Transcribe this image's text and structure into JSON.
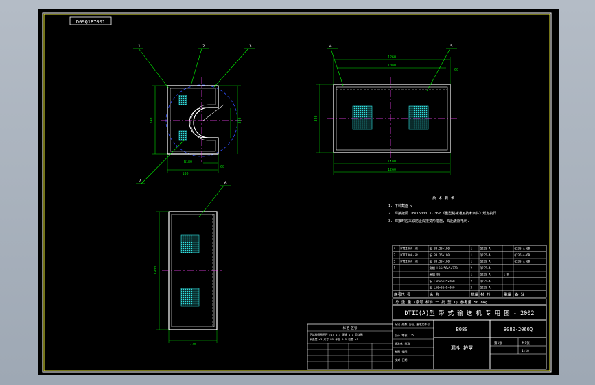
{
  "colors": {
    "background": "#000000",
    "frame": "#ffffff",
    "border_yellow": "#e8e830",
    "geometry_white": "#ffffff",
    "dimension_green": "#00dd00",
    "centerline_magenta": "#ff44ff",
    "hidden_blue": "#3050ff",
    "hatch_cyan": "#30e0e0",
    "leader_green": "#00ff00",
    "table_text": "#ffffff",
    "note_text": "#ffffff"
  },
  "drawing_code_box": "D09Q1B7001",
  "balloons": [
    "1",
    "2",
    "3",
    "4",
    "5",
    "6",
    "7"
  ],
  "notes": {
    "title": "技 术 要 求",
    "items": [
      "1. 下料截面 ▽",
      "2. 焊接按照 JB/T5000.3-1998《重型机械通用技术条件》规定执行.",
      "3. 焊接时应采取防止焊接变形措施, 焊后去除毛刺."
    ]
  },
  "parts_rows": [
    {
      "no": "4",
      "code": "DTII30A-5R",
      "name": "板 B3.25×190",
      "qty": "1",
      "mat": "Q235-A",
      "weight": "",
      "note": "Q235-A-6B"
    },
    {
      "no": "3",
      "code": "DTII30A-5R",
      "name": "板 B3.25×190",
      "qty": "1",
      "mat": "Q235-A",
      "weight": "",
      "note": "Q235-A-6B"
    },
    {
      "no": "2",
      "code": "DTII30A-5R",
      "name": "板 B3.25×190",
      "qty": "1",
      "mat": "Q235-A",
      "weight": "",
      "note": "Q235-A-6B"
    },
    {
      "no": "1",
      "code": "",
      "name": "角钢 L56×56×5×270",
      "qty": "2",
      "mat": "Q235-A",
      "weight": "",
      "note": ""
    },
    {
      "no": "",
      "code": "",
      "name": "角钢 B6",
      "qty": "1",
      "mat": "Q235-A",
      "weight": "1.8",
      "note": ""
    },
    {
      "no": "",
      "code": "",
      "name": "板 L56×56×5×260",
      "qty": "2",
      "mat": "Q235-A",
      "weight": "",
      "note": ""
    },
    {
      "no": "",
      "code": "",
      "name": "板 L56×56×5×260",
      "qty": "2",
      "mat": "Q235-A",
      "weight": "",
      "note": ""
    }
  ],
  "parts_header": [
    "序号",
    "代 号",
    "名 称",
    "数量",
    "材 料",
    "重量",
    "备 注"
  ],
  "total_row": "总 重 量  (序号 标准 一 批 签 1)  参考量  50.8kg",
  "title_bar": "DTII(A)型 带 式 输 送 机 专 用 图 - 2002",
  "code_box_left": "B080",
  "code_box_right": "B080-2060Q",
  "drawing_name": "漏斗 护罩",
  "approval_header": "标记 处数 分区 更改文件号",
  "approval_rows": [
    "设计 审核 1:5",
    "标准化 批准",
    "制图 描图",
    "校对 日期"
  ],
  "scale_labels": [
    "第1张",
    "共1张",
    "1:10"
  ],
  "rev_block": {
    "title": "标记 区号",
    "lines": [
      "下部按照图示开 (1)  ≤ 3  焊缝 1:1 见详图",
      "平面度 ±3  尺寸 B5 平面 9.5 位置 ±1"
    ]
  },
  "view_labels": {
    "front_dims": [
      "180",
      "240",
      "340",
      "60",
      "R180"
    ],
    "side_dims": [
      "1080",
      "1260",
      "60",
      "1180",
      "340"
    ],
    "top_dims": [
      "1200",
      "270"
    ]
  }
}
